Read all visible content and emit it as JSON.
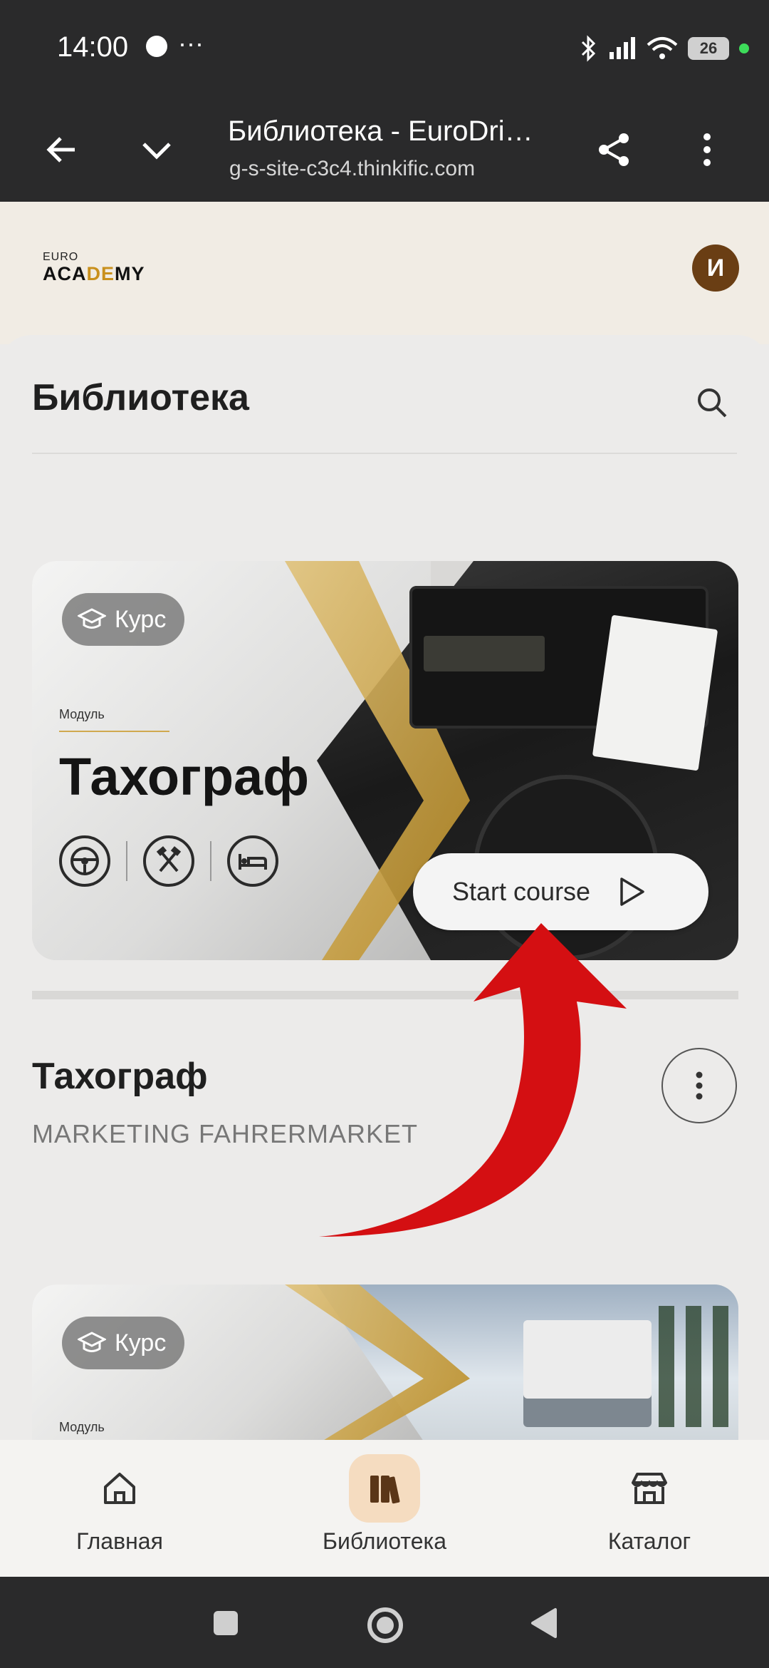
{
  "status_bar": {
    "time": "14:00",
    "dots": "···",
    "battery": "26"
  },
  "browser": {
    "title": "Библиотека - EuroDri…",
    "url": "g-s-site-c3c4.thinkific.com"
  },
  "site": {
    "logo_top": "EURO",
    "logo_main_pre": "ACA",
    "logo_main_accent": "DE",
    "logo_main_post": "MY",
    "avatar_initial": "И"
  },
  "library": {
    "title": "Библиотека"
  },
  "courses": [
    {
      "chip_label": "Курс",
      "image_module_label": "Модуль",
      "image_title": "Тахограф",
      "start_label": "Start course",
      "title": "Тахограф",
      "author": "MARKETING FAHRERMARKET"
    },
    {
      "chip_label": "Курс",
      "image_module_label": "Модуль"
    }
  ],
  "bottom_nav": {
    "items": [
      {
        "label": "Главная",
        "icon": "home-icon"
      },
      {
        "label": "Библиотека",
        "icon": "library-icon",
        "active": true
      },
      {
        "label": "Каталог",
        "icon": "store-icon"
      }
    ]
  },
  "colors": {
    "accent": "#f5dcc0",
    "avatar": "#6a3e14",
    "arrow": "#d40f12"
  }
}
